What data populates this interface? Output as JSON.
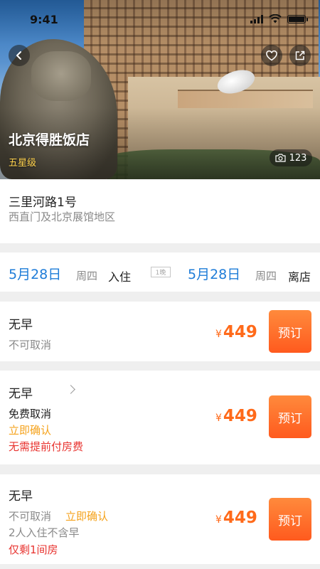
{
  "status_bar": {
    "time": "9:41"
  },
  "hotel": {
    "name": "北京得胜饭店",
    "star_level": "五星级",
    "photo_count": "123",
    "address_street": "三里河路1号",
    "address_area": "西直门及北京展馆地区"
  },
  "dates": {
    "checkin_date": "5月28日",
    "checkin_weekday": "周四",
    "checkin_label": "入住",
    "nights": "1晚",
    "checkout_date": "5月28日",
    "checkout_weekday": "周四",
    "checkout_label": "离店"
  },
  "rooms": [
    {
      "breakfast": "无早",
      "cancel": "不可取消",
      "currency": "¥",
      "price": "449",
      "book_label": "预订"
    },
    {
      "breakfast": "无早",
      "cancel": "免费取消",
      "confirm": "立即确认",
      "payment": "无需提前付房费",
      "currency": "¥",
      "price": "449",
      "book_label": "预订"
    },
    {
      "breakfast": "无早",
      "cancel": "不可取消",
      "confirm": "立即确认",
      "occupancy": "2人入住不含早",
      "stock": "仅剩1间房",
      "currency": "¥",
      "price": "449",
      "book_label": "预订"
    }
  ],
  "colors": {
    "date_blue": "#1e7cd8",
    "price_orange": "#ff6a1a",
    "confirm_orange": "#f5a21b",
    "alert_red": "#e8332f",
    "star_yellow": "#ffd24d"
  },
  "icons": [
    "back-arrow-icon",
    "heart-icon",
    "share-icon",
    "camera-icon",
    "chevron-right-icon"
  ]
}
